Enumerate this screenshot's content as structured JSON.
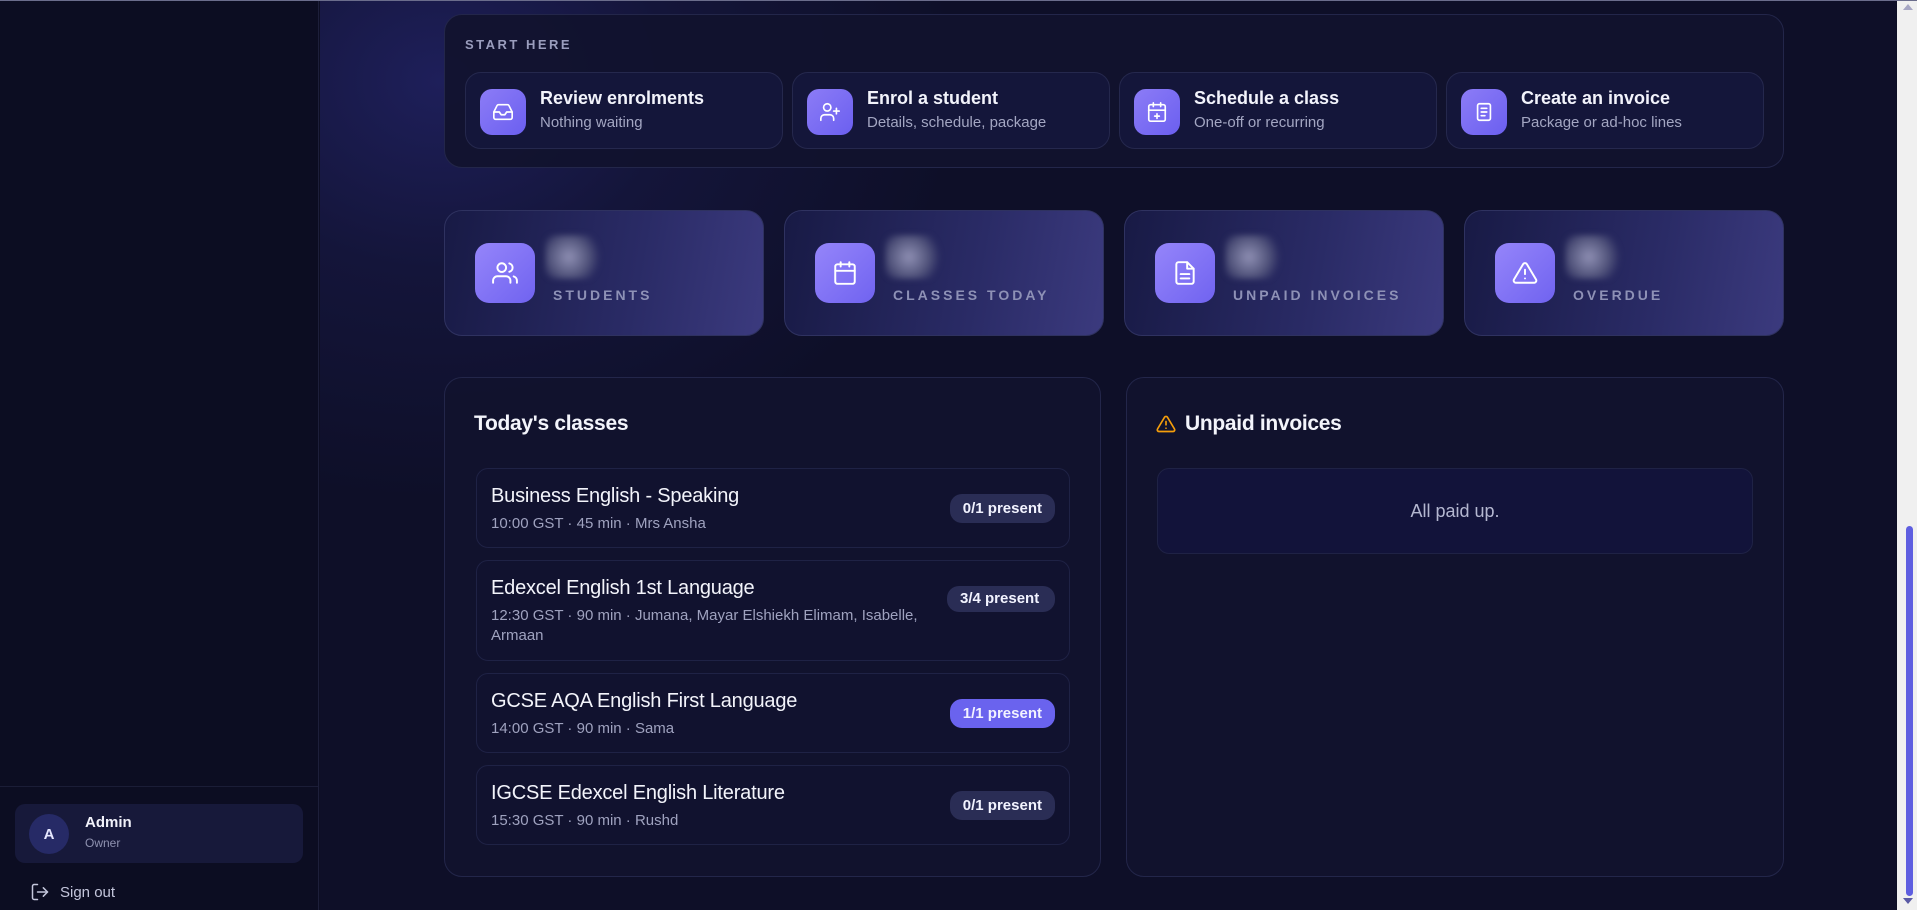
{
  "user": {
    "initial": "A",
    "name": "Admin",
    "role": "Owner",
    "signout": "Sign out"
  },
  "start": {
    "title": "START HERE",
    "actions": [
      {
        "title": "Review enrolments",
        "sub": "Nothing waiting",
        "icon": "inbox-icon"
      },
      {
        "title": "Enrol a student",
        "sub": "Details, schedule, package",
        "icon": "user-plus-icon"
      },
      {
        "title": "Schedule a class",
        "sub": "One-off or recurring",
        "icon": "calendar-plus-icon"
      },
      {
        "title": "Create an invoice",
        "sub": "Package or ad-hoc lines",
        "icon": "document-icon"
      }
    ]
  },
  "stats": [
    {
      "label": "STUDENTS",
      "icon": "users-icon"
    },
    {
      "label": "CLASSES TODAY",
      "icon": "calendar-icon"
    },
    {
      "label": "UNPAID INVOICES",
      "icon": "file-text-icon"
    },
    {
      "label": "OVERDUE",
      "icon": "alert-triangle-icon"
    }
  ],
  "classes": {
    "title": "Today's classes",
    "items": [
      {
        "name": "Business English - Speaking",
        "meta": "10:00 GST · 45 min · Mrs Ansha",
        "badge": "0/1 present"
      },
      {
        "name": "Edexcel English 1st Language",
        "meta": "12:30 GST · 90 min · Jumana, Mayar Elshiekh Elimam, Isabelle, Armaan",
        "badge": "3/4 present"
      },
      {
        "name": "GCSE AQA English First Language",
        "meta": "14:00 GST · 90 min · Sama",
        "badge": "1/1 present"
      },
      {
        "name": "IGCSE Edexcel English Literature",
        "meta": "15:30 GST · 90 min · Rushd",
        "badge": "0/1 present"
      }
    ]
  },
  "invoices": {
    "title": "Unpaid invoices",
    "empty": "All paid up."
  },
  "colors": {
    "accent": "#6a63ee",
    "warning": "#f59e0b",
    "background": "#0d0e24"
  }
}
